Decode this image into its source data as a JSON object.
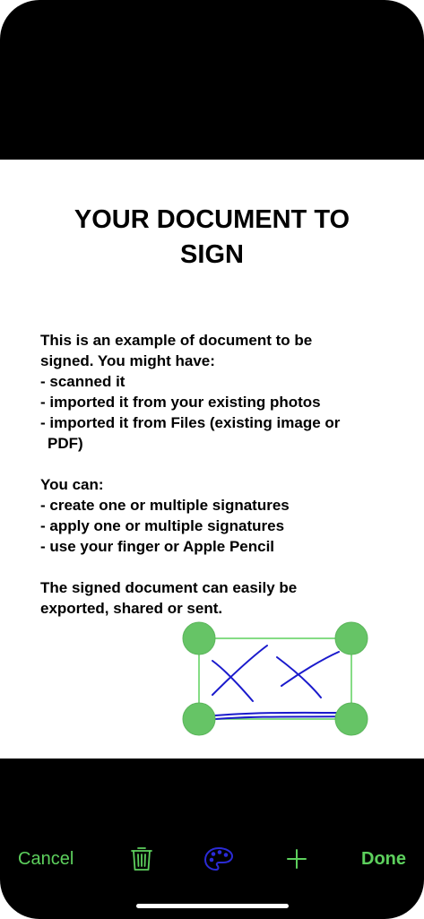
{
  "document": {
    "title_line1": "YOUR DOCUMENT TO",
    "title_line2": "SIGN",
    "paragraph1": [
      "This is an example of document to be",
      "signed. You might have:",
      "- scanned it",
      "- imported it from your existing photos",
      "- imported it from Files (existing image or",
      "PDF)"
    ],
    "paragraph2": [
      "You can:",
      "- create one or multiple signatures",
      "- apply one or multiple signatures",
      "- use your finger or Apple Pencil"
    ],
    "paragraph3": [
      "The signed document can easily be",
      "exported, shared or sent."
    ]
  },
  "toolbar": {
    "cancel_label": "Cancel",
    "done_label": "Done",
    "icons": [
      "trash-icon",
      "palette-icon",
      "plus-icon"
    ]
  },
  "colors": {
    "accent": "#5dd05d",
    "signature_ink": "#1a1acc",
    "palette_icon": "#2b2bd6",
    "background": "#000000",
    "page": "#ffffff"
  }
}
